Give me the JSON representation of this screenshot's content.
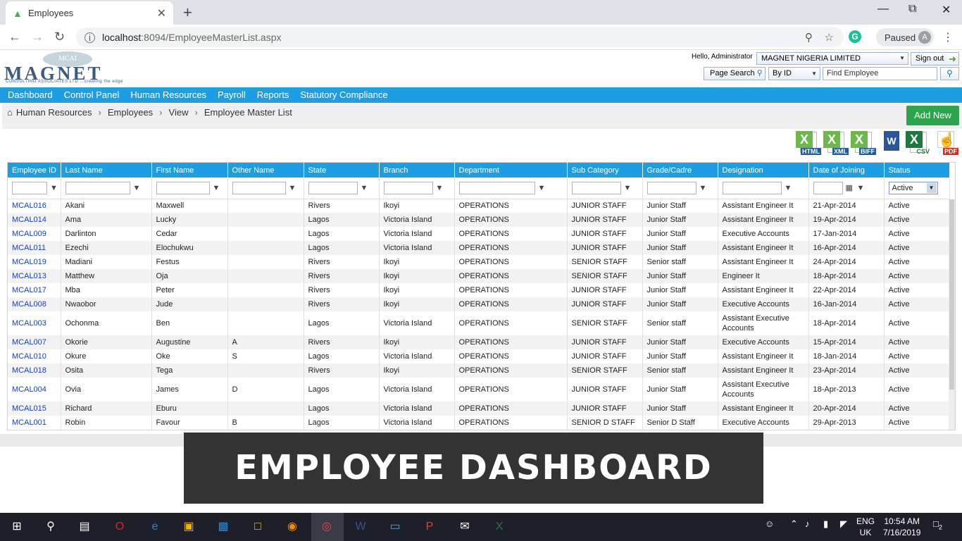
{
  "browser": {
    "tab_title": "Employees",
    "url_host": "localhost",
    "url_path": ":8094/EmployeeMasterList.aspx",
    "profile_status": "Paused",
    "profile_initial": "A"
  },
  "header": {
    "logo_badge": "MCAI",
    "logo_name": "MAGNET",
    "logo_tagline": "CONSULTING ASSOCIATES LTD ...creating the edge",
    "greeting": "Hello, Administrator",
    "company": "MAGNET NIGERIA LIMITED",
    "signout_label": "Sign out",
    "page_search_label": "Page Search",
    "search_by": "By ID",
    "find_placeholder": "Find Employee"
  },
  "menu": [
    "Dashboard",
    "Control Panel",
    "Human Resources",
    "Payroll",
    "Reports",
    "Statutory Compliance"
  ],
  "breadcrumb": [
    "Human Resources",
    "Employees",
    "View",
    "Employee Master List"
  ],
  "add_new_label": "Add New",
  "exports": [
    {
      "icon": "excel-icon",
      "label": "HTML"
    },
    {
      "icon": "excel-icon",
      "label": "XML"
    },
    {
      "icon": "excel-icon",
      "label": "BIFF"
    },
    {
      "icon": "word-icon",
      "label": ""
    },
    {
      "icon": "csv-icon",
      "label": "CSV"
    },
    {
      "icon": "pdf-icon",
      "label": "PDF"
    }
  ],
  "table": {
    "columns": [
      "Employee ID",
      "Last Name",
      "First Name",
      "Other Name",
      "State",
      "Branch",
      "Department",
      "Sub Category",
      "Grade/Cadre",
      "Designation",
      "Date of Joining",
      "Status"
    ],
    "status_filter": "Active",
    "rows": [
      [
        "MCAL016",
        "Akani",
        "Maxwell",
        "",
        "Rivers",
        "Ikoyi",
        "OPERATIONS",
        "JUNIOR STAFF",
        "Junior Staff",
        "Assistant Engineer It",
        "21-Apr-2014",
        "Active"
      ],
      [
        "MCAL014",
        "Ama",
        "Lucky",
        "",
        "Lagos",
        "Victoria Island",
        "OPERATIONS",
        "JUNIOR STAFF",
        "Junior Staff",
        "Assistant Engineer It",
        "19-Apr-2014",
        "Active"
      ],
      [
        "MCAL009",
        "Darlinton",
        "Cedar",
        "",
        "Lagos",
        "Victoria Island",
        "OPERATIONS",
        "JUNIOR STAFF",
        "Junior Staff",
        "Executive Accounts",
        "17-Jan-2014",
        "Active"
      ],
      [
        "MCAL011",
        "Ezechi",
        "Elochukwu",
        "",
        "Lagos",
        "Victoria Island",
        "OPERATIONS",
        "JUNIOR STAFF",
        "Junior Staff",
        "Assistant Engineer It",
        "16-Apr-2014",
        "Active"
      ],
      [
        "MCAL019",
        "Madiani",
        "Festus",
        "",
        "Rivers",
        "Ikoyi",
        "OPERATIONS",
        "SENIOR STAFF",
        "Senior staff",
        "Assistant Engineer It",
        "24-Apr-2014",
        "Active"
      ],
      [
        "MCAL013",
        "Matthew",
        "Oja",
        "",
        "Rivers",
        "Ikoyi",
        "OPERATIONS",
        "SENIOR STAFF",
        "Junior Staff",
        "Engineer It",
        "18-Apr-2014",
        "Active"
      ],
      [
        "MCAL017",
        "Mba",
        "Peter",
        "",
        "Rivers",
        "Ikoyi",
        "OPERATIONS",
        "JUNIOR STAFF",
        "Junior Staff",
        "Assistant Engineer It",
        "22-Apr-2014",
        "Active"
      ],
      [
        "MCAL008",
        "Nwaobor",
        "Jude",
        "",
        "Rivers",
        "Ikoyi",
        "OPERATIONS",
        "JUNIOR STAFF",
        "Junior Staff",
        "Executive Accounts",
        "16-Jan-2014",
        "Active"
      ],
      [
        "MCAL003",
        "Ochonma",
        "Ben",
        "",
        "Lagos",
        "Victoria Island",
        "OPERATIONS",
        "SENIOR STAFF",
        "Senior staff",
        "Assistant Executive Accounts",
        "18-Apr-2014",
        "Active"
      ],
      [
        "MCAL007",
        "Okorie",
        "Augustine",
        "A",
        "Rivers",
        "Ikoyi",
        "OPERATIONS",
        "JUNIOR STAFF",
        "Junior Staff",
        "Executive Accounts",
        "15-Apr-2014",
        "Active"
      ],
      [
        "MCAL010",
        "Okure",
        "Oke",
        "S",
        "Lagos",
        "Victoria Island",
        "OPERATIONS",
        "JUNIOR STAFF",
        "Junior Staff",
        "Assistant Engineer It",
        "18-Jan-2014",
        "Active"
      ],
      [
        "MCAL018",
        "Osita",
        "Tega",
        "",
        "Rivers",
        "Ikoyi",
        "OPERATIONS",
        "SENIOR STAFF",
        "Senior staff",
        "Assistant Engineer It",
        "23-Apr-2014",
        "Active"
      ],
      [
        "MCAL004",
        "Ovia",
        "James",
        "D",
        "Lagos",
        "Victoria Island",
        "OPERATIONS",
        "JUNIOR STAFF",
        "Junior Staff",
        "Assistant Executive Accounts",
        "18-Apr-2013",
        "Active"
      ],
      [
        "MCAL015",
        "Richard",
        "Eburu",
        "",
        "Lagos",
        "Victoria Island",
        "OPERATIONS",
        "JUNIOR STAFF",
        "Junior Staff",
        "Assistant Engineer It",
        "20-Apr-2014",
        "Active"
      ],
      [
        "MCAL001",
        "Robin",
        "Favour",
        "B",
        "Lagos",
        "Victoria Island",
        "OPERATIONS",
        "SENIOR D STAFF",
        "Senior D Staff",
        "Executive Accounts",
        "29-Apr-2013",
        "Active"
      ]
    ]
  },
  "overlay_text": "EMPLOYEE DASHBOARD",
  "taskbar": {
    "lang_top": "ENG",
    "lang_bottom": "UK",
    "time": "10:54 AM",
    "date": "7/16/2019",
    "notification_count": "2"
  }
}
